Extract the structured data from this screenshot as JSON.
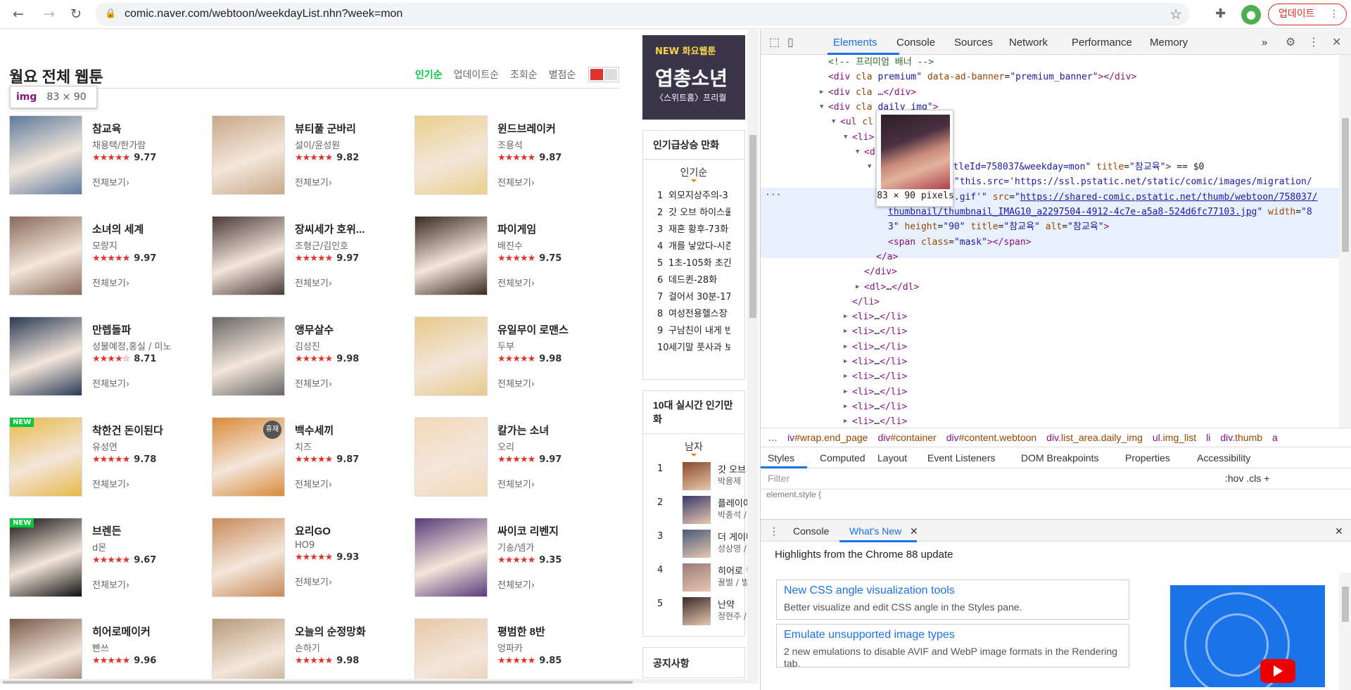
{
  "browser": {
    "url": "comic.naver.com/webtoon/weekdayList.nhn?week=mon",
    "update_label": "업데이트",
    "icons": [
      "back-icon",
      "forward-icon",
      "reload-icon",
      "lock-icon",
      "star-icon",
      "puzzle-icon",
      "avatar-icon",
      "kebab-icon"
    ]
  },
  "page": {
    "title": "월요 전체 웹툰",
    "sort_tabs": [
      "인기순",
      "업데이트순",
      "조회순",
      "별점순"
    ],
    "tooltip_tag": "img",
    "tooltip_size": "83 × 90",
    "more_label": "전체보기",
    "items": [
      {
        "title": "참교육",
        "author": "채용택/한가람",
        "stars": "★★★★★",
        "score": "9.77",
        "color": "#5d7a9c",
        "badge": ""
      },
      {
        "title": "뷰티풀 군바리",
        "author": "설이/윤성원",
        "stars": "★★★★★",
        "score": "9.82",
        "color": "#c9a88a",
        "badge": ""
      },
      {
        "title": "윈드브레이커",
        "author": "조용석",
        "stars": "★★★★★",
        "score": "9.87",
        "color": "#e9d08a",
        "badge": ""
      },
      {
        "title": "소녀의 세계",
        "author": "모랑지",
        "stars": "★★★★★",
        "score": "9.97",
        "color": "#8a6a5a",
        "badge": ""
      },
      {
        "title": "장씨세가 호위...",
        "author": "조형근/김인호",
        "stars": "★★★★★",
        "score": "9.97",
        "color": "#4a3a3a",
        "badge": ""
      },
      {
        "title": "파이게임",
        "author": "배진수",
        "stars": "★★★★★",
        "score": "9.75",
        "color": "#3a2a20",
        "badge": ""
      },
      {
        "title": "만렙돌파",
        "author": "성불예정,홍실 / 미노",
        "stars": "★★★★☆",
        "score": "8.71",
        "color": "#2a3a55",
        "badge": ""
      },
      {
        "title": "앵무살수",
        "author": "김성진",
        "stars": "★★★★★",
        "score": "9.98",
        "color": "#666666",
        "badge": ""
      },
      {
        "title": "유일무이 로맨스",
        "author": "두부",
        "stars": "★★★★★",
        "score": "9.98",
        "color": "#e7c98a",
        "badge": ""
      },
      {
        "title": "착한건 돈이된다",
        "author": "유성연",
        "stars": "★★★★★",
        "score": "9.78",
        "color": "#e8b84a",
        "badge": "NEW"
      },
      {
        "title": "백수세끼",
        "author": "치즈",
        "stars": "★★★★★",
        "score": "9.87",
        "color": "#d98a3a",
        "badge": "휴재"
      },
      {
        "title": "칼가는 소녀",
        "author": "오리",
        "stars": "★★★★★",
        "score": "9.97",
        "color": "#f3d8b8",
        "badge": ""
      },
      {
        "title": "브렌든",
        "author": "d몬",
        "stars": "★★★★★",
        "score": "9.67",
        "color": "#111111",
        "badge": "NEW"
      },
      {
        "title": "요리GO",
        "author": "HO9",
        "stars": "★★★★★",
        "score": "9.93",
        "color": "#c98a5a",
        "badge": ""
      },
      {
        "title": "싸이코 리벤지",
        "author": "기송/넴가",
        "stars": "★★★★★",
        "score": "9.35",
        "color": "#5a3a7a",
        "badge": ""
      },
      {
        "title": "히어로메이커",
        "author": "빤쓰",
        "stars": "★★★★★",
        "score": "9.96",
        "color": "#7a5a4a",
        "badge": ""
      },
      {
        "title": "오늘의 순정망화",
        "author": "손하기",
        "stars": "★★★★★",
        "score": "9.98",
        "color": "#b89a7a",
        "badge": ""
      },
      {
        "title": "평범한 8반",
        "author": "엉파카",
        "stars": "★★★★★",
        "score": "9.85",
        "color": "#e8c8a8",
        "badge": ""
      }
    ],
    "promo": {
      "line1": "NEW 화요웹툰",
      "line2": "엽총소년",
      "line3": "〈스위트홈〉프리퀄"
    },
    "rising": {
      "heading": "인기급상승 만화",
      "subtab": "인기순",
      "items": [
        {
          "n": "1",
          "t": "외모지상주의-3"
        },
        {
          "n": "2",
          "t": "갓 오브 하이스쿨"
        },
        {
          "n": "3",
          "t": "재혼 황후-73화"
        },
        {
          "n": "4",
          "t": "개를 낳았다-시즌"
        },
        {
          "n": "5",
          "t": "1초-105화 초긴"
        },
        {
          "n": "6",
          "t": "데드퀸-28화"
        },
        {
          "n": "7",
          "t": "걸어서 30분-17"
        },
        {
          "n": "8",
          "t": "여성전용헬스장"
        },
        {
          "n": "9",
          "t": "구남친이 내게 반"
        },
        {
          "n": "10",
          "t": "세기말 풋사과 보"
        }
      ]
    },
    "realtime": {
      "heading": "10대 실시간 인기만화",
      "subtab": "남자",
      "items": [
        {
          "n": "1",
          "t": "갓 오브",
          "a": "박용제",
          "color": "#8a4a2a"
        },
        {
          "n": "2",
          "t": "플레이어",
          "a": "박종석 /",
          "color": "#3a3a6a"
        },
        {
          "n": "3",
          "t": "더 게이머",
          "a": "성상영 /",
          "color": "#4a5a7a"
        },
        {
          "n": "4",
          "t": "히어로 킬",
          "a": "꿀벌 / 벌",
          "color": "#9a7a7a"
        },
        {
          "n": "5",
          "t": "난약",
          "a": "정현주 /",
          "color": "#3a2a2a"
        }
      ]
    },
    "notice": "공지사항"
  },
  "devtools": {
    "tabs": [
      "Elements",
      "Console",
      "Sources",
      "Network",
      "Performance",
      "Memory"
    ],
    "more": "»",
    "preview_caption": "83 × 90 pixels",
    "dom_lines": [
      {
        "indent": 0,
        "arrow": "",
        "html": "<span class='cm'>&lt;!-- 프리미엄 배너 --&gt;</span>"
      },
      {
        "indent": 0,
        "arrow": "",
        "html": "<span class='tg'>&lt;div</span> <span class='at'>cla</span>            <span class='av'>premium\"</span> <span class='at'>data-ad-banner</span>=<span class='av'>\"premium_banner\"</span><span class='tg'>&gt;&lt;/div&gt;</span>"
      },
      {
        "indent": 0,
        "arrow": "▶",
        "html": "<span class='tg'>&lt;div</span> <span class='at'>cla</span>          <span class='tg'>…&lt;/div&gt;</span>"
      },
      {
        "indent": 0,
        "arrow": "▼",
        "html": "<span class='tg'>&lt;div</span> <span class='at'>cla</span>          <span class='av'>daily_img\"</span><span class='tg'>&gt;</span>"
      },
      {
        "indent": 1,
        "arrow": "▼",
        "html": "<span class='tg'>&lt;ul</span> <span class='at'>cl</span>"
      },
      {
        "indent": 2,
        "arrow": "▼",
        "html": "<span class='tg'>&lt;li&gt;</span>"
      },
      {
        "indent": 3,
        "arrow": "▼",
        "html": "<span class='tg'>&lt;d</span>          <span class='tg'>&gt;</span>"
      },
      {
        "indent": 4,
        "arrow": "▼",
        "html": "         <span class='av'>on/list.nhn?titleId=758037&amp;weekday=mon\"</span> <span class='at'>title</span>=<span class='av'>\"참교육\"</span><span class='tg'>&gt;</span> <span class='tx'>== $0</span>"
      },
      {
        "indent": 5,
        "arrow": "",
        "html": "<span class='tg'>&lt;img</span> <span class='at'>on</span>   <span class='at'>ror</span>=<span class='av'>\"this.src='https://ssl.pstatic.net/static/comic/images/migration/</span>"
      },
      {
        "indent": 5,
        "arrow": "",
        "html": "<span class='av'>common/blank.gif'\"</span> <span class='at'>src</span>=<span class='av'>\"</span><span class='lk'>https://shared-comic.pstatic.net/thumb/webtoon/758037/</span>"
      },
      {
        "indent": 5,
        "arrow": "",
        "html": "<span class='lk'>thumbnail/thumbnail_IMAG10_a2297504-4912-4c7e-a5a8-524d6fc77103.jpg</span><span class='av'>\"</span> <span class='at'>width</span>=<span class='av'>\"8</span>"
      },
      {
        "indent": 5,
        "arrow": "",
        "html": "<span class='av'>3\"</span> <span class='at'>height</span>=<span class='av'>\"90\"</span> <span class='at'>title</span>=<span class='av'>\"참교육\"</span> <span class='at'>alt</span>=<span class='av'>\"참교육\"</span><span class='tg'>&gt;</span>"
      },
      {
        "indent": 5,
        "arrow": "",
        "html": "<span class='tg'>&lt;span</span> <span class='at'>class</span>=<span class='av'>\"mask\"</span><span class='tg'>&gt;&lt;/span&gt;</span>"
      },
      {
        "indent": 4,
        "arrow": "",
        "html": "<span class='tg'>&lt;/a&gt;</span>"
      },
      {
        "indent": 3,
        "arrow": "",
        "html": "<span class='tg'>&lt;/div&gt;</span>"
      },
      {
        "indent": 3,
        "arrow": "▶",
        "html": "<span class='tg'>&lt;dl&gt;</span>…<span class='tg'>&lt;/dl&gt;</span>"
      },
      {
        "indent": 2,
        "arrow": "",
        "html": "<span class='tg'>&lt;/li&gt;</span>"
      },
      {
        "indent": 2,
        "arrow": "▶",
        "html": "<span class='tg'>&lt;li&gt;</span>…<span class='tg'>&lt;/li&gt;</span>"
      },
      {
        "indent": 2,
        "arrow": "▶",
        "html": "<span class='tg'>&lt;li&gt;</span>…<span class='tg'>&lt;/li&gt;</span>"
      },
      {
        "indent": 2,
        "arrow": "▶",
        "html": "<span class='tg'>&lt;li&gt;</span>…<span class='tg'>&lt;/li&gt;</span>"
      },
      {
        "indent": 2,
        "arrow": "▶",
        "html": "<span class='tg'>&lt;li&gt;</span>…<span class='tg'>&lt;/li&gt;</span>"
      },
      {
        "indent": 2,
        "arrow": "▶",
        "html": "<span class='tg'>&lt;li&gt;</span>…<span class='tg'>&lt;/li&gt;</span>"
      },
      {
        "indent": 2,
        "arrow": "▶",
        "html": "<span class='tg'>&lt;li&gt;</span>…<span class='tg'>&lt;/li&gt;</span>"
      },
      {
        "indent": 2,
        "arrow": "▶",
        "html": "<span class='tg'>&lt;li&gt;</span>…<span class='tg'>&lt;/li&gt;</span>"
      },
      {
        "indent": 2,
        "arrow": "▶",
        "html": "<span class='tg'>&lt;li&gt;</span>…<span class='tg'>&lt;/li&gt;</span>"
      }
    ],
    "crumbs": [
      {
        "t": "…",
        "c": ""
      },
      {
        "t": "iv",
        "c": "#wrap.end_page"
      },
      {
        "t": "div",
        "c": "#container"
      },
      {
        "t": "div",
        "c": "#content.webtoon"
      },
      {
        "t": "div",
        "c": ".list_area.daily_img"
      },
      {
        "t": "ul",
        "c": ".img_list"
      },
      {
        "t": "li",
        "c": ""
      },
      {
        "t": "div",
        "c": ".thumb"
      },
      {
        "t": "a",
        "c": ""
      }
    ],
    "style_tabs": [
      "Styles",
      "Computed",
      "Layout",
      "Event Listeners",
      "DOM Breakpoints",
      "Properties",
      "Accessibility"
    ],
    "filter_placeholder": "Filter",
    "filter_right": ":hov   .cls   +",
    "element_style": "element.style {",
    "drawer_tabs": [
      "Console",
      "What's New"
    ],
    "whats_new_heading": "Highlights from the Chrome 88 update",
    "cards": [
      {
        "h": "New CSS angle visualization tools",
        "d": "Better visualize and edit CSS angle in the Styles pane."
      },
      {
        "h": "Emulate unsupported image types",
        "d": "2 new emulations to disable AVIF and WebP image formats in the Rendering tab."
      }
    ]
  }
}
